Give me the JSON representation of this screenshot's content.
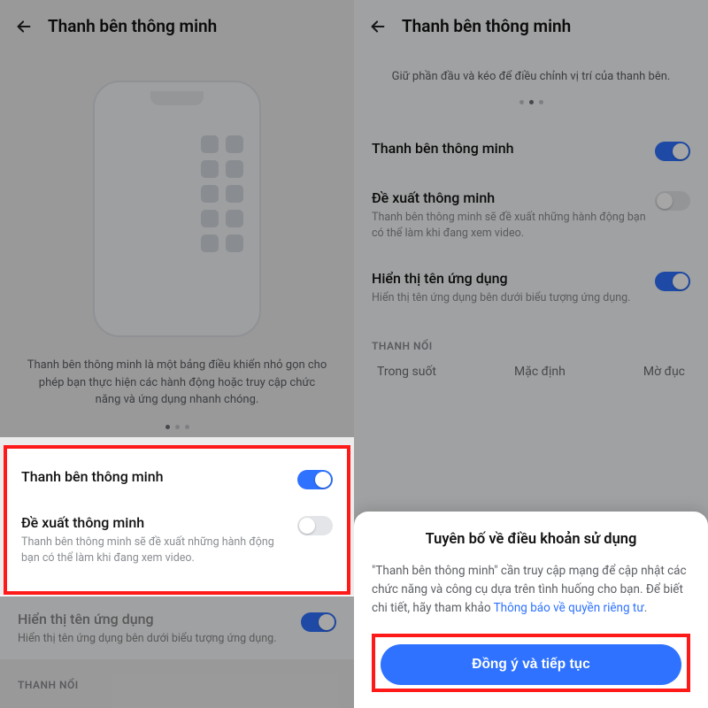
{
  "header_title": "Thanh bên thông minh",
  "left": {
    "intro": "Thanh bên thông minh là một bảng điều khiển nhỏ gọn cho phép bạn thực hiện các hành động hoặc truy cập chức năng và ứng dụng nhanh chóng.",
    "smart_sidebar": {
      "title": "Thanh bên thông minh"
    },
    "smart_suggest": {
      "title": "Đề xuất thông minh",
      "desc": "Thanh bên thông minh sẽ đề xuất những hành động bạn có thể làm khi đang xem video."
    },
    "show_app_name": {
      "title": "Hiển thị tên ứng dụng",
      "desc": "Hiển thị tên ứng dụng bên dưới biểu tượng ứng dụng."
    },
    "section_handle": "THANH NỔI"
  },
  "right": {
    "instruction": "Giữ phần đầu và kéo để điều chỉnh vị trí của thanh bên.",
    "smart_sidebar": {
      "title": "Thanh bên thông minh"
    },
    "smart_suggest": {
      "title": "Đề xuất thông minh",
      "desc": "Thanh bên thông minh sẽ đề xuất những hành động bạn có thể làm khi đang xem video."
    },
    "show_app_name": {
      "title": "Hiển thị tên ứng dụng",
      "desc": "Hiển thị tên ứng dụng bên dưới biểu tượng ứng dụng."
    },
    "section_handle": "THANH NỔI",
    "opacity": {
      "transparent": "Trong suốt",
      "default": "Mặc định",
      "opaque": "Mờ đục"
    },
    "sheet": {
      "title": "Tuyên bố về điều khoản sử dụng",
      "body_prefix": "\"Thanh bên thông minh\" cần truy cập mạng để cập nhật các chức năng và công cụ dựa trên tình huống cho bạn. Để biết chi tiết, hãy tham khảo ",
      "link": "Thông báo về quyền riêng tư",
      "body_suffix": ".",
      "button": "Đồng ý và tiếp tục"
    }
  }
}
